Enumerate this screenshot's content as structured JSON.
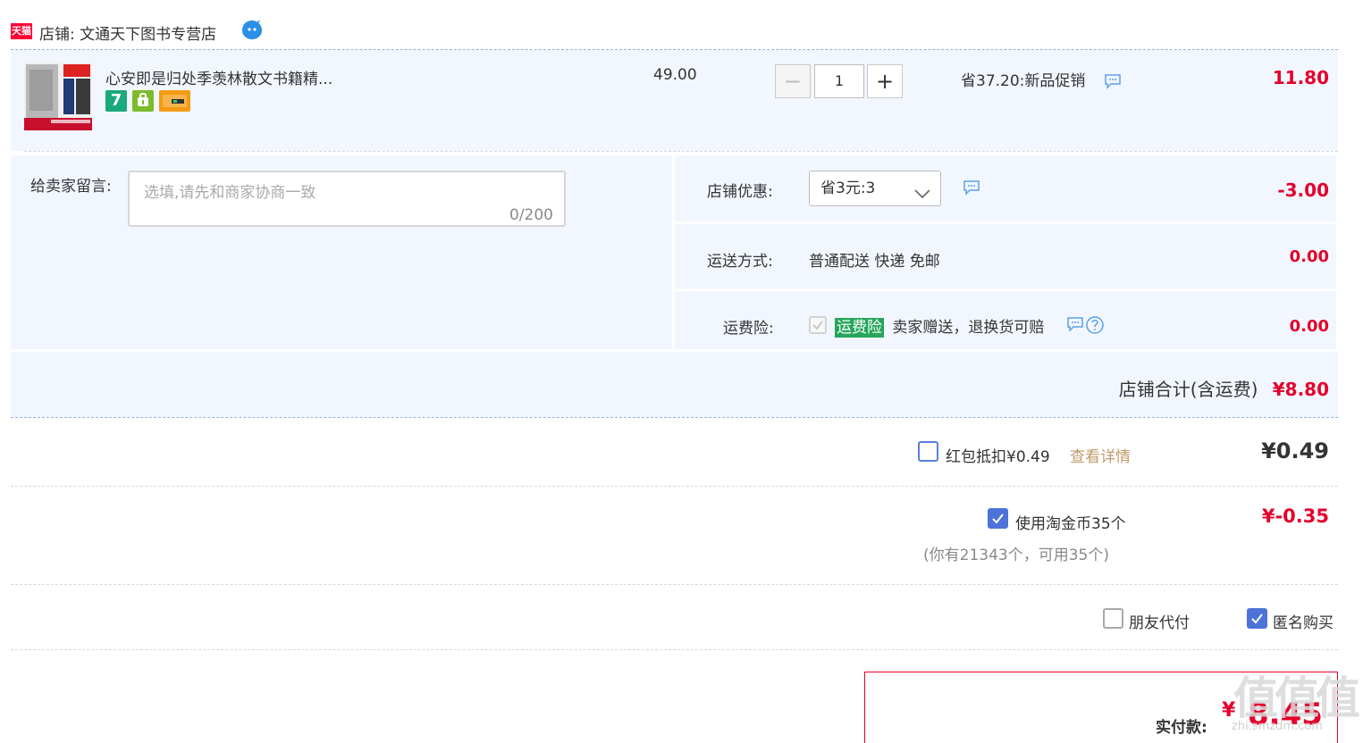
{
  "shop": {
    "logo_text": "天猫",
    "label": "店铺: 文通天下图书专营店"
  },
  "item": {
    "title": "心安即是归处季羡林散文书籍精...",
    "unit_price": "49.00",
    "quantity": "1",
    "promo": "省37.20:新品促销",
    "subtotal": "11.80",
    "badge_seven": "7"
  },
  "message": {
    "label": "给卖家留言:",
    "placeholder": "选填,请先和商家协商一致",
    "counter": "0/200"
  },
  "discount": {
    "label": "店铺优惠:",
    "selected": "省3元:3",
    "amount": "-3.00"
  },
  "shipping": {
    "label": "运送方式:",
    "value": "普通配送 快递 免邮",
    "amount": "0.00"
  },
  "insurance": {
    "label": "运费险:",
    "tag": "运费险",
    "text": "卖家赠送，退换货可赔",
    "amount": "0.00"
  },
  "shop_total": {
    "label": "店铺合计(含运费)",
    "value": "¥8.80"
  },
  "redpacket": {
    "label": "红包抵扣¥0.49",
    "link": "查看详情",
    "amount": "¥0.49"
  },
  "coins": {
    "label": "使用淘金币35个",
    "sub": "(你有21343个，可用35个)",
    "amount": "¥-0.35"
  },
  "options": {
    "friend_pay": "朋友代付",
    "anonymous": "匿名购买"
  },
  "payment": {
    "label": "实付款:",
    "currency": "¥",
    "value": "8.45"
  },
  "watermark": {
    "main": "值",
    "sub": "zhi.smzdm.com"
  },
  "colors": {
    "price_red": "#e4002b",
    "panel_blue": "#f2f7ff",
    "checkbox_blue": "#4d73d9",
    "insurance_green": "#26a65b",
    "link_orange": "#c09a6b"
  },
  "icons": [
    "tmall-logo-icon",
    "wangwang-chat-icon",
    "comment-icon",
    "help-icon",
    "chevron-down-icon",
    "check-icon"
  ]
}
